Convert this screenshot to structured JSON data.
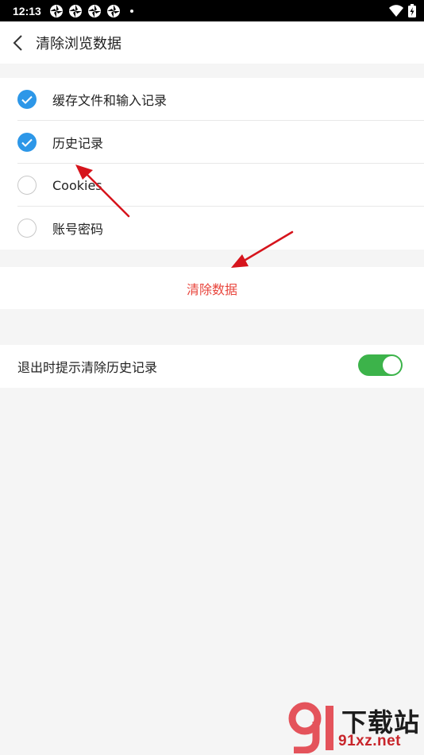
{
  "status_bar": {
    "time": "12:13",
    "notification_icons": [
      "aperture-icon",
      "aperture-icon",
      "aperture-icon",
      "aperture-icon"
    ],
    "right_icons": [
      "wifi-icon",
      "battery-charging-icon"
    ]
  },
  "header": {
    "back_icon": "chevron-left-icon",
    "title": "清除浏览数据"
  },
  "options": [
    {
      "label": "缓存文件和输入记录",
      "checked": true
    },
    {
      "label": "历史记录",
      "checked": true
    },
    {
      "label": "Cookies",
      "checked": false
    },
    {
      "label": "账号密码",
      "checked": false
    }
  ],
  "clear_button": {
    "label": "清除数据",
    "color": "#e8453c"
  },
  "exit_prompt": {
    "label": "退出时提示清除历史记录",
    "enabled": true
  },
  "colors": {
    "check_blue": "#2d97e8",
    "switch_green": "#3cb34a",
    "annotation_red": "#d6141c"
  },
  "watermark": {
    "text_top": "下载站",
    "text_bottom": "91xz.net"
  }
}
